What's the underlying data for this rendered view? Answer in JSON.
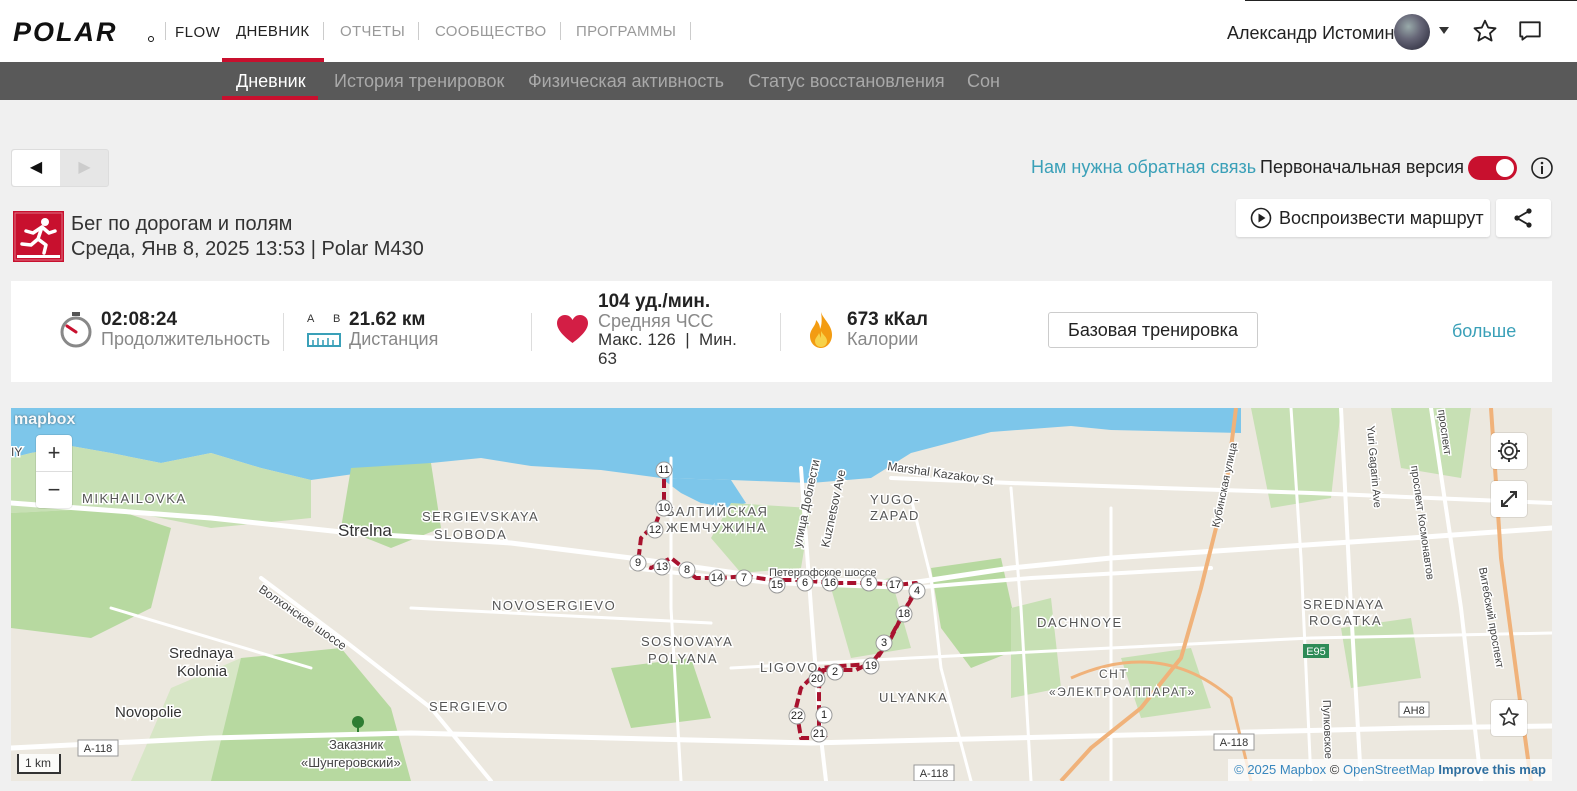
{
  "header": {
    "logo": "POLAR",
    "product": "FLOW",
    "nav": [
      "ДНЕВНИК",
      "ОТЧЕТЫ",
      "СООБЩЕСТВО",
      "ПРОГРАММЫ"
    ],
    "user_name": "Александр Истомин",
    "icons": [
      "chevron-down-icon",
      "star-icon",
      "message-icon"
    ]
  },
  "subnav": [
    "Дневник",
    "История тренировок",
    "Физическая активность",
    "Статус восстановления",
    "Сон"
  ],
  "toolbar": {
    "prev_glyph": "◀",
    "next_glyph": "▶",
    "feedback": "Нам нужна обратная связь",
    "original_version": "Первоначальная версия",
    "toggle_on": true
  },
  "session": {
    "sport": "Бег по дорогам и полям",
    "datetime": "Среда, Янв 8, 2025 13:53 | Polar M430",
    "play_route": "Воспроизвести маршрут"
  },
  "stats": {
    "duration": "02:08:24",
    "duration_label": "Продолжительность",
    "ab_a": "A",
    "ab_b": "B",
    "distance": "21.62 км",
    "distance_label": "Дистанция",
    "hr": "104 уд./мин.",
    "hr_label": "Средняя ЧСС",
    "hr_range_1": "Макс. 126  |  Мин.",
    "hr_range_2": "63",
    "calories": "673 кКал",
    "calories_label": "Калории",
    "base_training": "Базовая тренировка",
    "more": "больше"
  },
  "map": {
    "logo": "mapbox",
    "zoom_in": "+",
    "zoom_out": "−",
    "scale": "1 km",
    "attribution_copyright": "© 2025 Mapbox",
    "attribution_sep": "©",
    "attribution_osm": "OpenStreetMap",
    "attribution_improve": "Improve this map",
    "labels": {
      "mikhailovka": "MIKHAILOVKA",
      "strelna": "Strelna",
      "sergievskaya": "SERGIEVSKAYA",
      "sloboda": "SLOBODA",
      "baltic1": "БАЛТИЙСКАЯ",
      "baltic2": "ЖЕМЧУЖИНА",
      "yugo": "YUGO-",
      "zapad": "ZAPAD",
      "kazakov": "Marshal Kazakov St",
      "dobl": "улица Доблести",
      "kuzn": "Kuznetsov Ave",
      "peterh": "Петергофское шоссе",
      "novosergievo": "NOVOSERGIEVO",
      "volkon": "Волхонское шоссе",
      "srednaya": "Srednaya",
      "kolonia": "Kolonia",
      "novopolie": "Novopolie",
      "sosnovaya": "SOSNOVAYA",
      "polyana": "POLYANA",
      "ligovo": "LIGOVO",
      "ulyanka": "ULYANKA",
      "sergievo": "SERGIEVO",
      "zakaznik1": "Заказник",
      "zakaznik2": "«Шунгеровский»",
      "dachnoye": "DACHNOYE",
      "snt": "СНТ",
      "electro": "«ЭЛЕКТРОАППАРАТ»",
      "srednaya_r1": "SREDNAYA",
      "srednaya_r2": "ROGATKA",
      "kubinskaya": "Кубинская улица",
      "yuri": "Yuri Gagarin Ave",
      "kosmonavt": "проспект Космонавтов",
      "vitebsky": "Витебский проспект",
      "prospekt": "проспект",
      "pulkovskoe": "Пулковское",
      "a118_1": "A-118",
      "a118_2": "A-118",
      "a118_3": "A-118",
      "e95": "E95",
      "ah8": "AH8",
      "iy": "IY"
    },
    "km_markers": [
      "1",
      "2",
      "3",
      "4",
      "5",
      "6",
      "7",
      "8",
      "9",
      "10",
      "11",
      "12",
      "13",
      "14",
      "15",
      "16",
      "17",
      "18",
      "19",
      "20",
      "21",
      "22"
    ],
    "route_color": "#a8122e"
  }
}
